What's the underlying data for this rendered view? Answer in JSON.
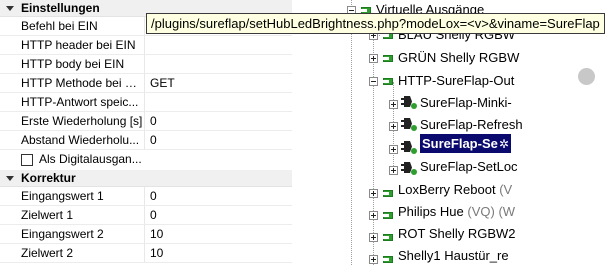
{
  "properties": {
    "categories": [
      {
        "label": "Einstellungen",
        "rows": [
          {
            "name": "Befehl bei EIN",
            "value": ""
          },
          {
            "name": "HTTP header bei EIN",
            "value": ""
          },
          {
            "name": "HTTP body bei EIN",
            "value": ""
          },
          {
            "name": "HTTP Methode bei EIN",
            "value": "GET"
          },
          {
            "name": "HTTP-Antwort speic...",
            "value": ""
          },
          {
            "name": "Erste Wiederholung [s]",
            "value": "0"
          },
          {
            "name": "Abstand Wiederholu...",
            "value": "0"
          },
          {
            "name": "Als Digitalausgan...",
            "value": "",
            "checkbox": true
          }
        ]
      },
      {
        "label": "Korrektur",
        "rows": [
          {
            "name": "Eingangswert 1",
            "value": "0"
          },
          {
            "name": "Zielwert 1",
            "value": "0"
          },
          {
            "name": "Eingangswert 2",
            "value": "10"
          },
          {
            "name": "Zielwert 2",
            "value": "10"
          }
        ]
      }
    ]
  },
  "tooltip": {
    "text": "/plugins/sureflap/setHubLedBrightness.php?modeLox=<v>&viname=SureFlap"
  },
  "tree": {
    "nodes": [
      {
        "label": "Virtuelle Ausgänge",
        "sub": ""
      },
      {
        "label": "BLAU Shelly RGBW",
        "sub": ""
      },
      {
        "label": "GRÜN Shelly RGBW",
        "sub": ""
      },
      {
        "label": "HTTP-SureFlap-Out",
        "sub": ""
      },
      {
        "label": "SureFlap-Minki-",
        "sub": ""
      },
      {
        "label": "SureFlap-Refresh",
        "sub": ""
      },
      {
        "label": "SureFlap-Se",
        "sub": "",
        "selected": true
      },
      {
        "label": "SureFlap-SetLoc",
        "sub": ""
      },
      {
        "label": "LoxBerry Reboot",
        "sub": "(V"
      },
      {
        "label": "Philips Hue",
        "sub": "(VQ) (W"
      },
      {
        "label": "ROT Shelly RGBW2",
        "sub": ""
      },
      {
        "label": "Shelly1 Haustür_re",
        "sub": ""
      }
    ]
  },
  "colors": {
    "selection": "#0a0a6e",
    "folder_green": "#2e9e2e",
    "tooltip_bg": "#ffffe1",
    "category_bg": "#f0f0f0"
  },
  "icons": {
    "collapse": "minus-box-icon",
    "expand": "plus-box-icon",
    "output_folder": "green-output-icon",
    "plug": "plug-output-icon",
    "gear": "gear-icon"
  }
}
